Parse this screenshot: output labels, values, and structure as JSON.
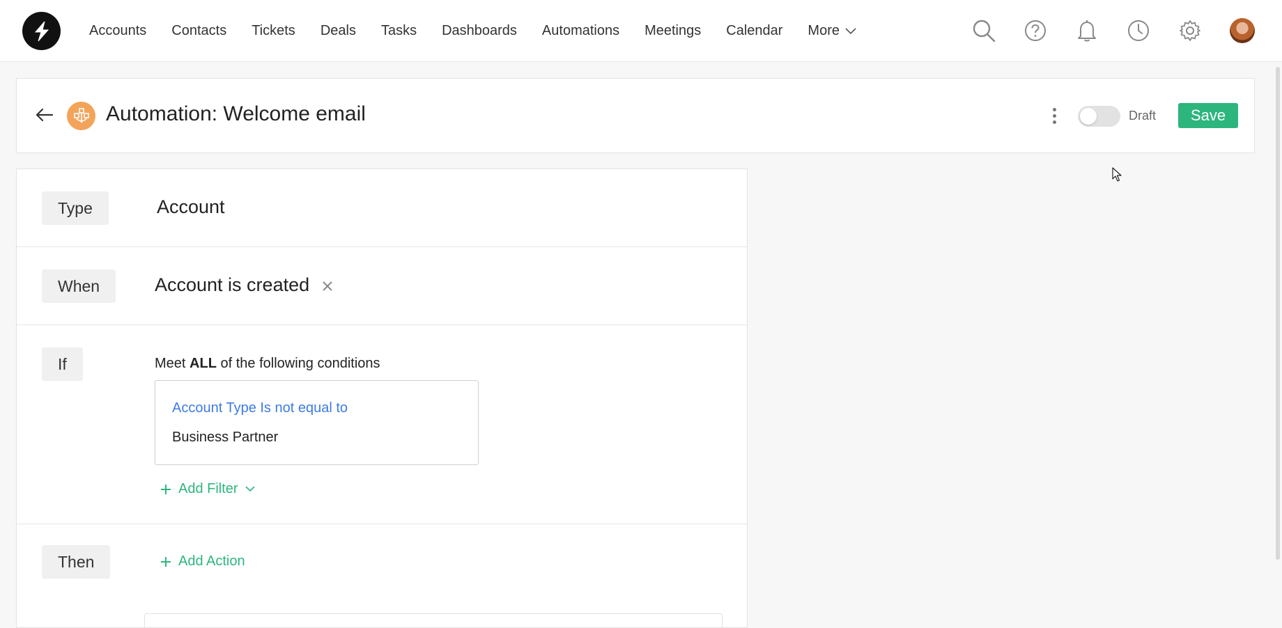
{
  "nav": {
    "items": [
      {
        "label": "Accounts"
      },
      {
        "label": "Contacts"
      },
      {
        "label": "Tickets"
      },
      {
        "label": "Deals"
      },
      {
        "label": "Tasks"
      },
      {
        "label": "Dashboards"
      },
      {
        "label": "Automations"
      },
      {
        "label": "Meetings"
      },
      {
        "label": "Calendar"
      }
    ],
    "more_label": "More",
    "icons": [
      "search-icon",
      "help-icon",
      "bell-icon",
      "clock-icon",
      "gear-icon"
    ]
  },
  "header": {
    "title": "Automation: Welcome email",
    "toggle_state": "off",
    "draft_label": "Draft",
    "save_label": "Save"
  },
  "form": {
    "type": {
      "tag": "Type",
      "value": "Account"
    },
    "when": {
      "tag": "When",
      "value": "Account is created"
    },
    "if": {
      "tag": "If",
      "cond_prefix": "Meet",
      "cond_match": "ALL",
      "cond_suffix": "of the following conditions",
      "filter": {
        "field": "Account Type Is not equal to",
        "value": "Business Partner"
      },
      "add_filter_label": "Add Filter"
    },
    "then": {
      "tag": "Then",
      "add_action_label": "Add Action"
    }
  },
  "colors": {
    "accent_green": "#2cb67d",
    "link_blue": "#3d7be6",
    "automation_icon": "#f3a45a"
  }
}
